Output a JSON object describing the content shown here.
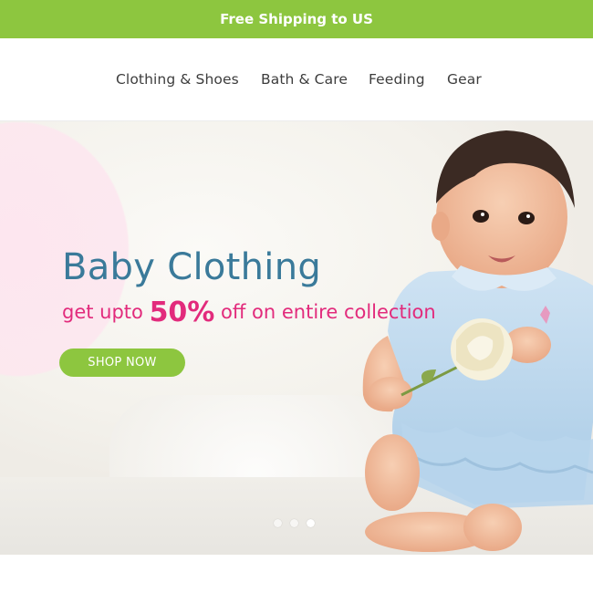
{
  "announcement": {
    "text": "Free Shipping to US"
  },
  "nav": {
    "items": [
      {
        "label": "Clothing & Shoes"
      },
      {
        "label": "Bath & Care"
      },
      {
        "label": "Feeding"
      },
      {
        "label": "Gear"
      }
    ]
  },
  "hero": {
    "title": "Baby Clothing",
    "subtitle_pre": "get upto ",
    "subtitle_highlight": "50%",
    "subtitle_post": " off on entire collection",
    "button_label": "SHOP NOW",
    "slides_count": 3,
    "active_slide": 3
  },
  "colors": {
    "brand_green": "#8dc63f",
    "title_blue": "#3a7a9a",
    "accent_pink": "#e22b7c"
  }
}
